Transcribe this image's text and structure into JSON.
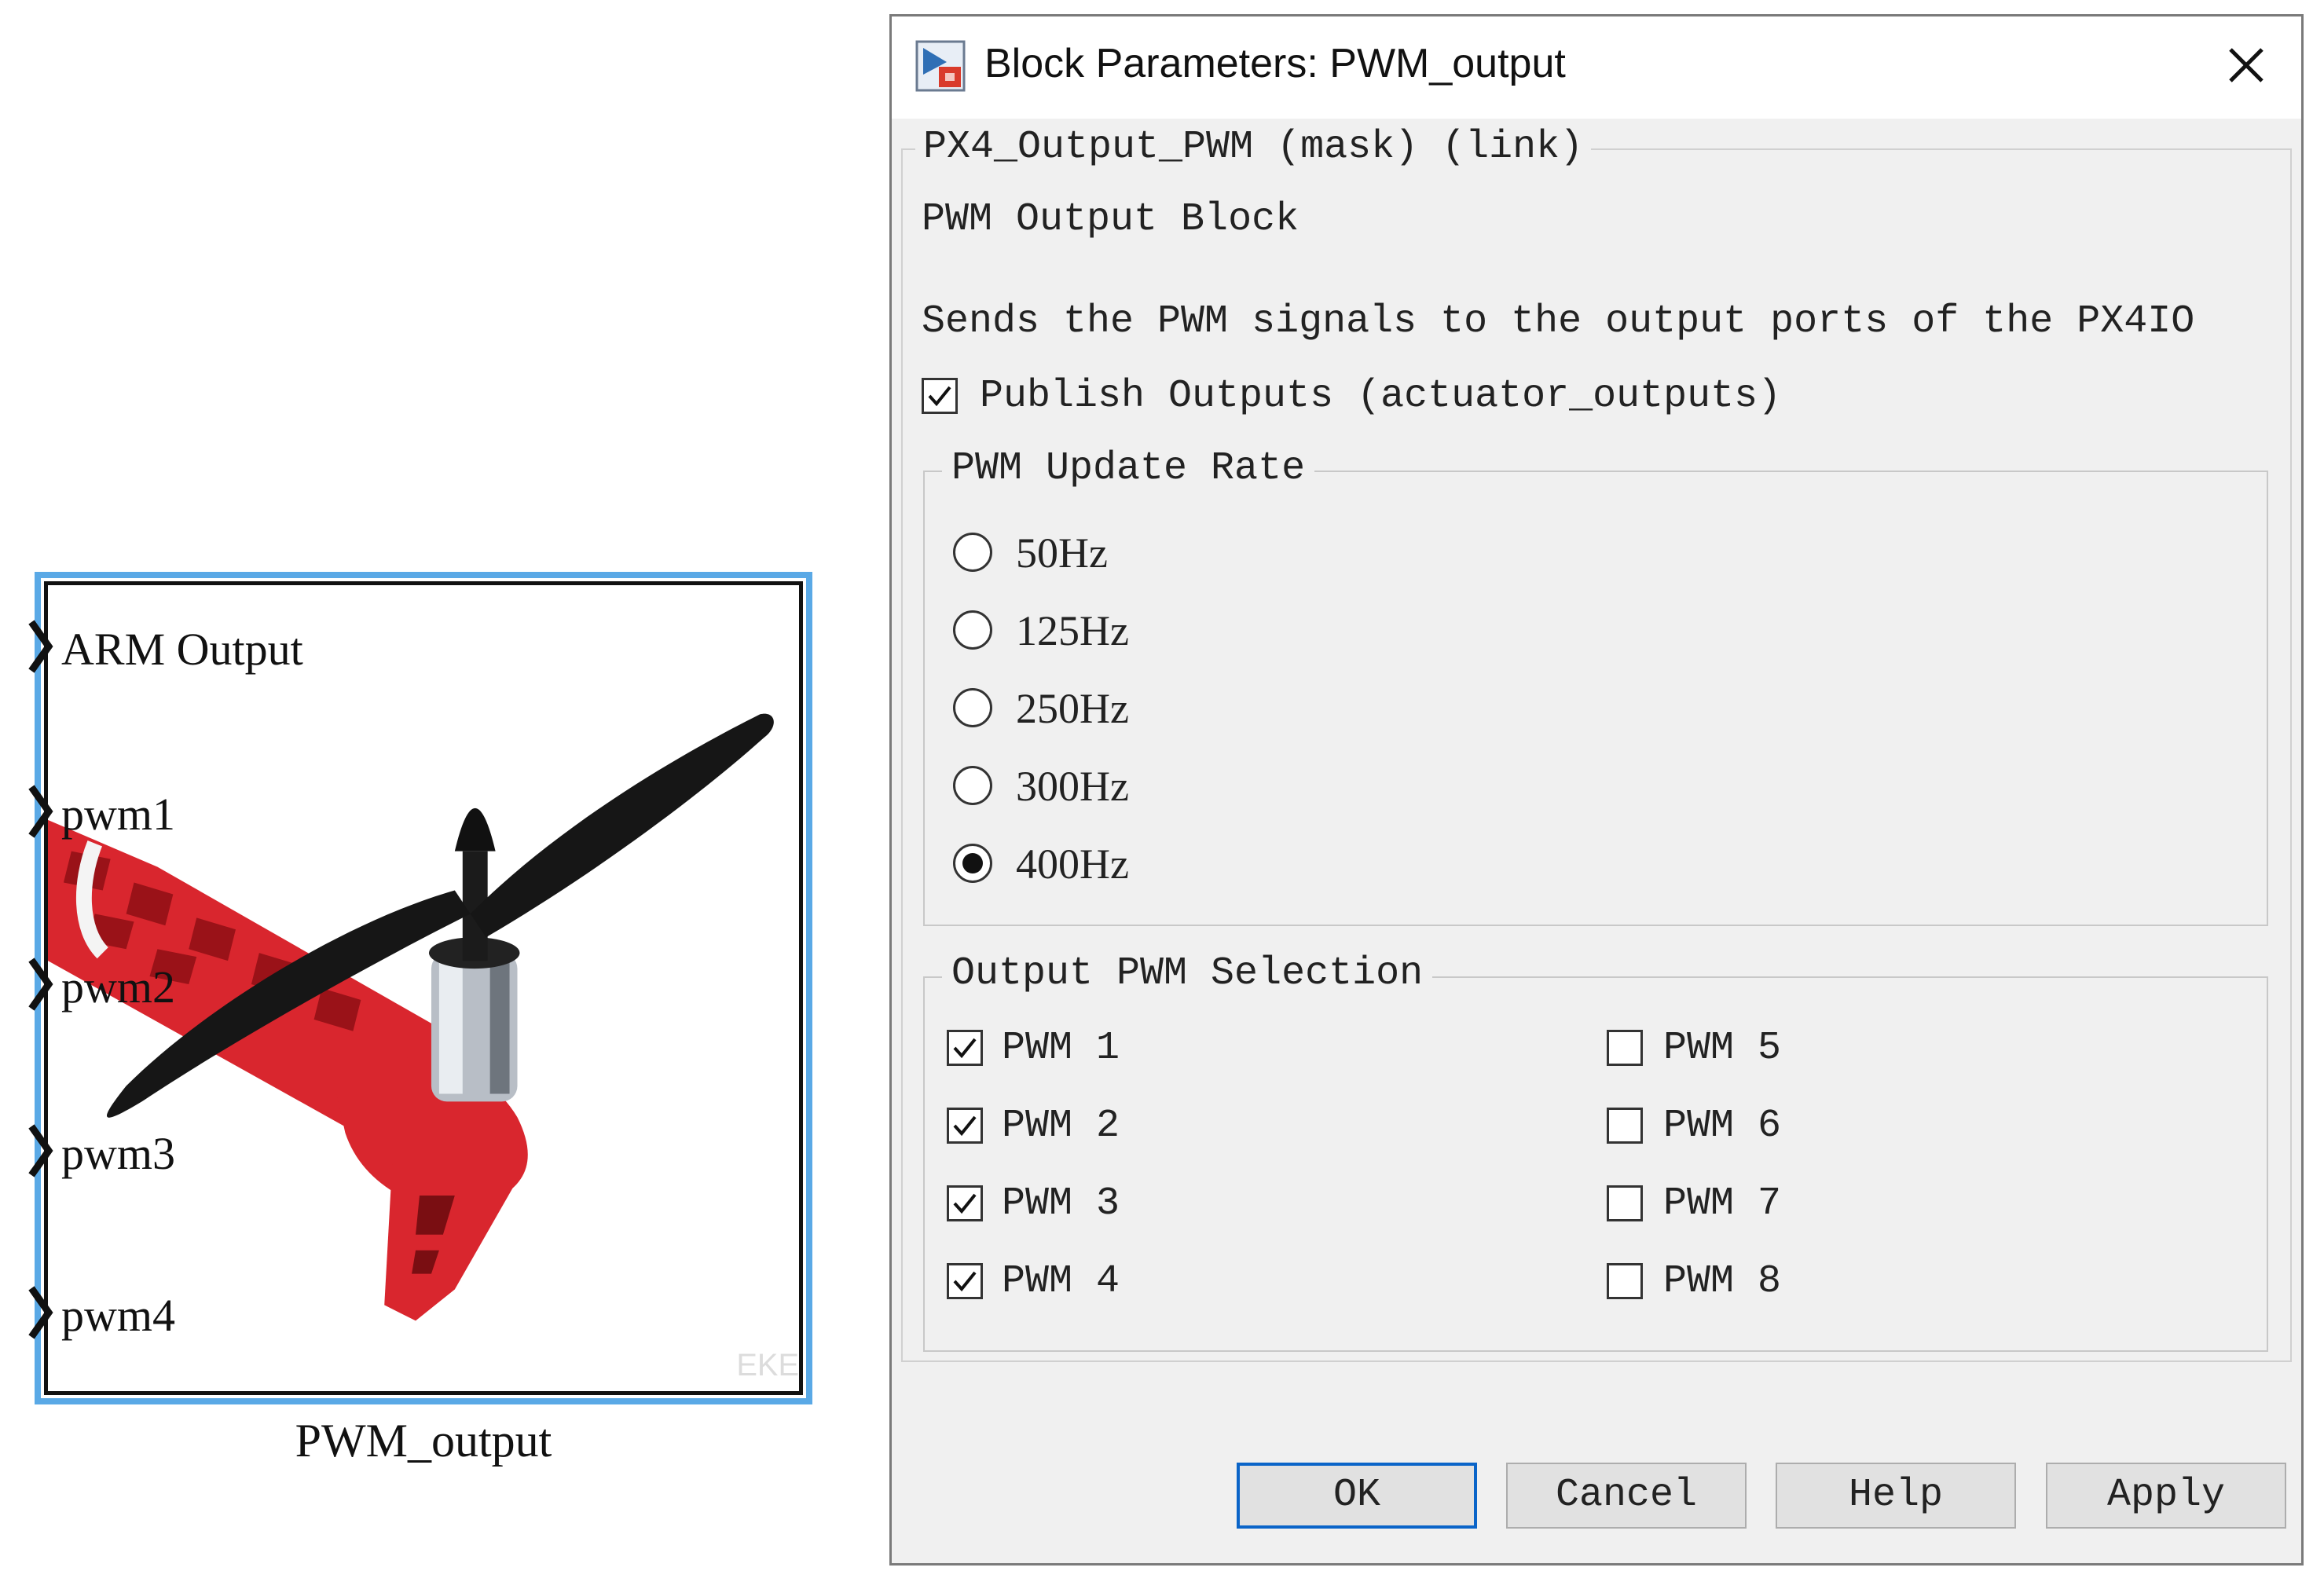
{
  "block": {
    "name": "PWM_output",
    "ports": [
      "ARM Output",
      "pwm1",
      "pwm2",
      "pwm3",
      "pwm4"
    ],
    "image": "quadcopter-motor-propeller-image"
  },
  "dialog": {
    "title": "Block Parameters: PWM_output",
    "mask_title": "PX4_Output_PWM (mask) (link)",
    "block_desc_title": "PWM Output Block",
    "block_desc": "Sends the PWM signals to the output ports of the PX4IO",
    "publish": {
      "label": "Publish Outputs (actuator_outputs)",
      "checked": true
    },
    "update_rate": {
      "title": "PWM Update Rate",
      "options": [
        "50Hz",
        "125Hz",
        "250Hz",
        "300Hz",
        "400Hz"
      ],
      "selected": "400Hz"
    },
    "selection": {
      "title": "Output PWM Selection",
      "left": [
        {
          "label": "PWM 1",
          "checked": true
        },
        {
          "label": "PWM 2",
          "checked": true
        },
        {
          "label": "PWM 3",
          "checked": true
        },
        {
          "label": "PWM 4",
          "checked": true
        }
      ],
      "right": [
        {
          "label": "PWM 5",
          "checked": false
        },
        {
          "label": "PWM 6",
          "checked": false
        },
        {
          "label": "PWM 7",
          "checked": false
        },
        {
          "label": "PWM 8",
          "checked": false
        }
      ]
    },
    "buttons": {
      "ok": "OK",
      "cancel": "Cancel",
      "help": "Help",
      "apply": "Apply"
    }
  },
  "colors": {
    "block_border": "#5aa9e6",
    "default_button_border": "#0a64c8",
    "frame_red": "#d9262e"
  }
}
